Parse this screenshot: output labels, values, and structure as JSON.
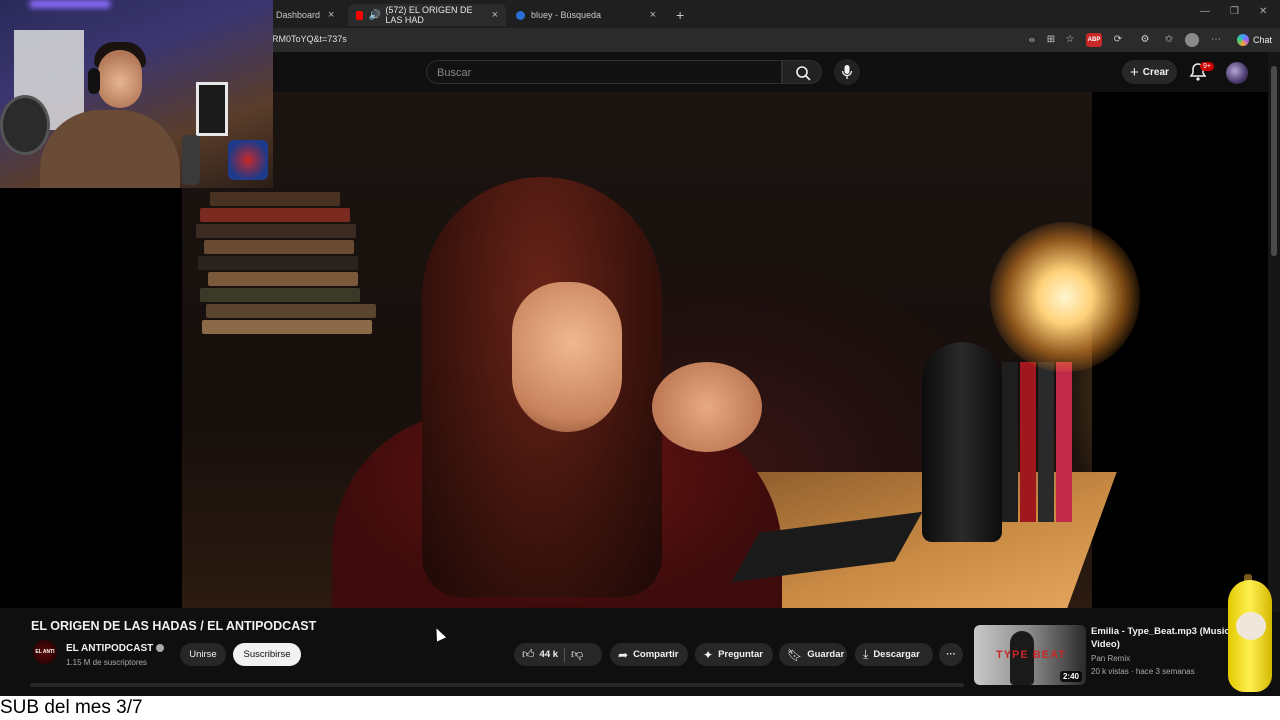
{
  "browser": {
    "tabs": [
      {
        "label": "Dashboard"
      },
      {
        "label": "(572) EL ORIGEN DE LAS HAD"
      },
      {
        "label": "bluey - Búsqueda"
      }
    ],
    "new_tab": "+",
    "url": "RM0ToYQ&t=737s",
    "chat_label": "Chat",
    "abp_label": "ABP"
  },
  "youtube": {
    "search_placeholder": "Buscar",
    "create_label": "Crear",
    "notifications_badge": "9+"
  },
  "video": {
    "title": "EL ORIGEN DE LAS HADAS / EL ANTIPODCAST",
    "channel": "EL ANTIPODCAST",
    "channel_logo_text": "EL ANTI",
    "subscribers": "1.15 M de suscriptores",
    "join_label": "Unirse",
    "subscribe_label": "Suscribirse",
    "likes": "44 k",
    "share_label": "Compartir",
    "ask_label": "Preguntar",
    "save_label": "Guardar",
    "download_label": "Descargar",
    "more_label": "···"
  },
  "recommended": {
    "title": "Emilia - Type_Beat.mp3 (Music Video)",
    "channel": "Pan Remix",
    "meta": "20 k vistas · hace 3 semanas",
    "duration": "2:40",
    "thumb_text": "TYPE BEAT"
  },
  "overlay": {
    "sub_text": "SUB del mes 3/7"
  },
  "colors": {
    "background": "#0f0f0f",
    "accent_red": "#cc0000",
    "pill": "#272727"
  }
}
